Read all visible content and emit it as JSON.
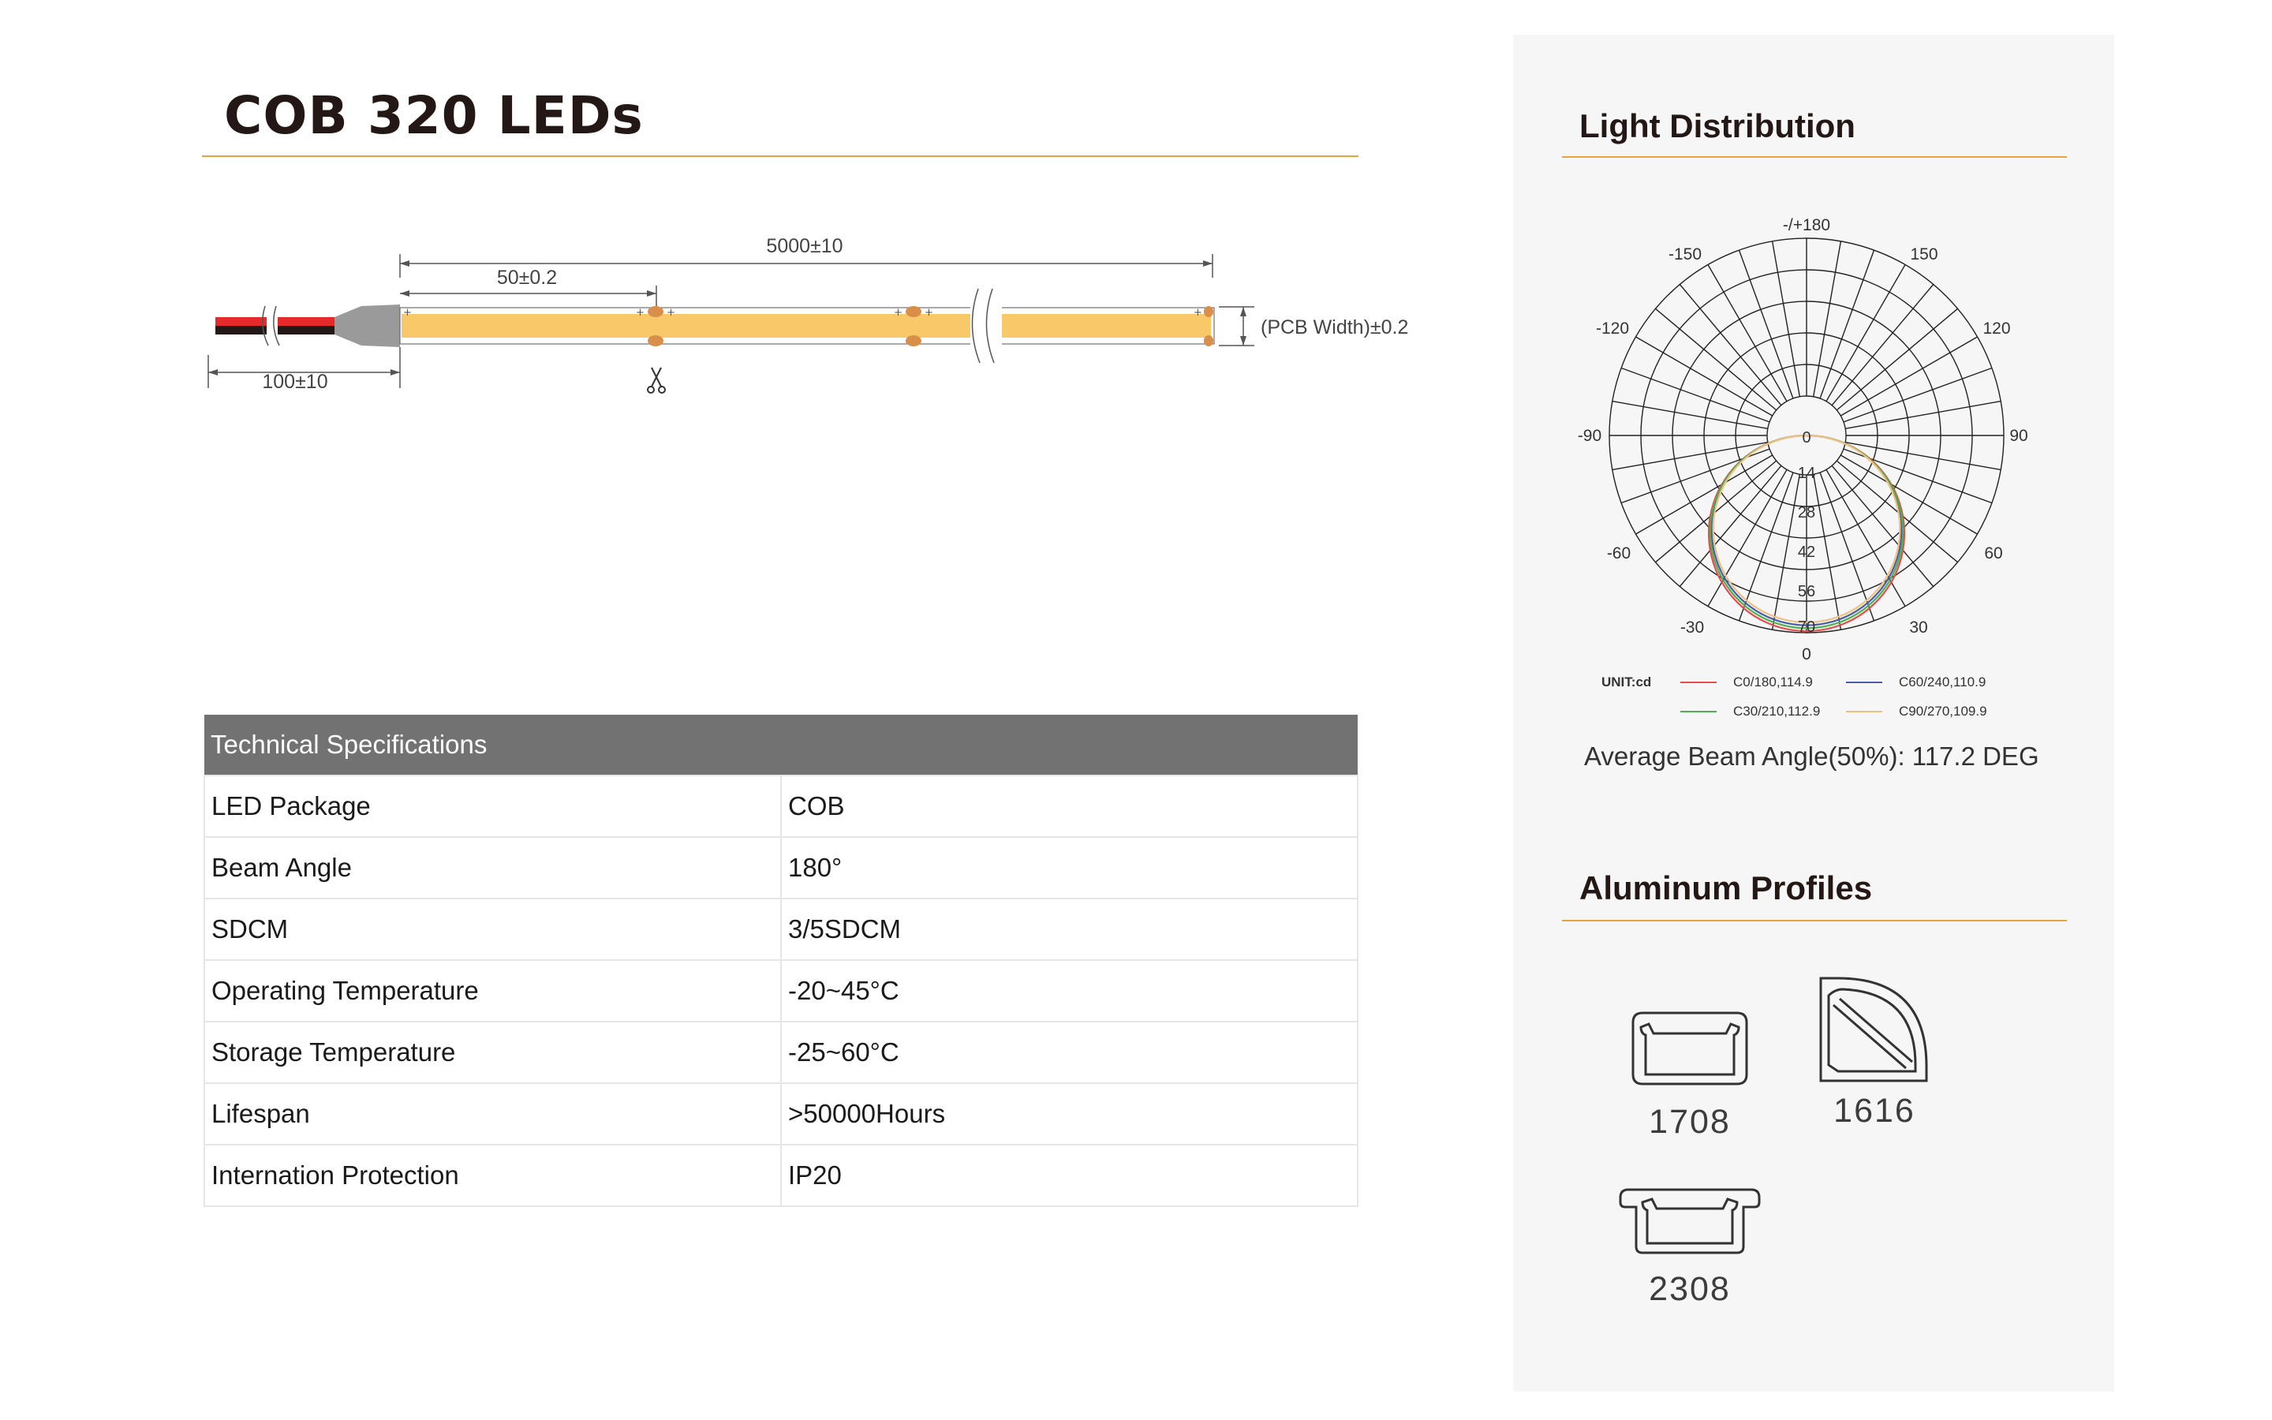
{
  "header": {
    "title": "COB 320 LEDs"
  },
  "drawing": {
    "total_length": "5000±10",
    "segment_length": "50±0.2",
    "lead_length": "100±10",
    "pcb_width": "(PCB Width)±0.2",
    "pad_plus": "+",
    "colors": {
      "strip": "#f9c868",
      "pad": "#d98f4a",
      "wire_red": "#e6292b",
      "wire_black": "#231815",
      "connector": "#9a9a9a"
    }
  },
  "specs": {
    "header": "Technical Specifications",
    "rows": [
      {
        "label": "LED Package",
        "value": "COB"
      },
      {
        "label": "Beam Angle",
        "value": "180°"
      },
      {
        "label": "SDCM",
        "value": "3/5SDCM"
      },
      {
        "label": "Operating Temperature",
        "value": "-20~45°C"
      },
      {
        "label": "Storage Temperature",
        "value": "-25~60°C"
      },
      {
        "label": "Lifespan",
        "value": ">50000Hours"
      },
      {
        "label": "Internation Protection",
        "value": "IP20"
      }
    ]
  },
  "light_distribution": {
    "title": "Light Distribution",
    "angle_labels": [
      "-/+180",
      "150",
      "120",
      "90",
      "60",
      "30",
      "0",
      "-30",
      "-60",
      "-90",
      "-120",
      "-150"
    ],
    "radial_labels": [
      "0",
      "14",
      "28",
      "42",
      "56",
      "70"
    ],
    "unit": "UNIT:cd",
    "legend": [
      {
        "label": "C0/180,114.9",
        "color": "#e84c4c"
      },
      {
        "label": "C60/240,110.9",
        "color": "#4a5ea8"
      },
      {
        "label": "C30/210,112.9",
        "color": "#4caf50"
      },
      {
        "label": "C90/270,109.9",
        "color": "#f0c080"
      }
    ],
    "beam_angle_text": "Average Beam Angle(50%): 117.2 DEG"
  },
  "profiles": {
    "title": "Aluminum Profiles",
    "items": [
      {
        "code": "1708",
        "icon": "channel-profile-icon"
      },
      {
        "code": "1616",
        "icon": "corner-profile-icon"
      },
      {
        "code": "2308",
        "icon": "flange-profile-icon"
      }
    ]
  },
  "colors": {
    "accent": "#e8a33d",
    "table_header": "#727272",
    "panel_bg": "#f6f6f6"
  }
}
